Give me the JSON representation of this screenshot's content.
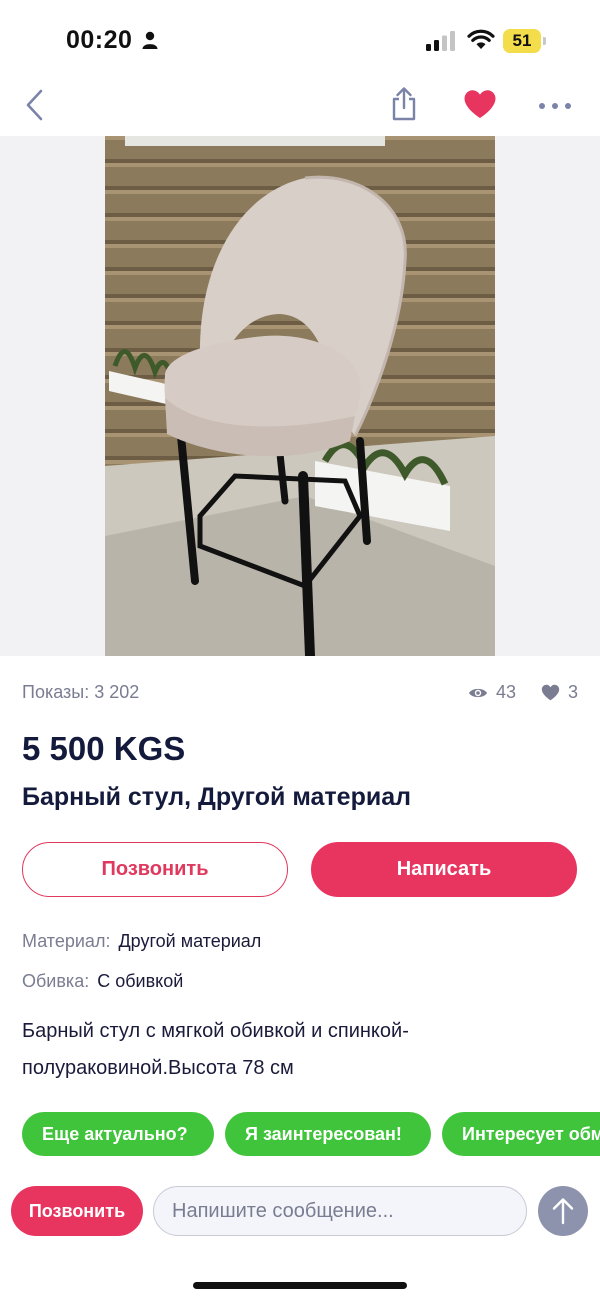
{
  "status_bar": {
    "time": "00:20",
    "battery": "51"
  },
  "listing": {
    "impressions": "Показы: 3 202",
    "views": "43",
    "likes": "3",
    "price": "5 500 KGS",
    "title": "Барный стул, Другой материал"
  },
  "actions": {
    "call_label": "Позвонить",
    "write_label": "Написать"
  },
  "attributes": [
    {
      "label": "Материал:",
      "value": "Другой материал"
    },
    {
      "label": "Обивка:",
      "value": "С обивкой"
    }
  ],
  "description": "Барный стул с мягкой обивкой и спинкой-полураковиной.Высота 78 см",
  "quick_replies": [
    "Еще актуально?",
    "Я заинтересован!",
    "Интересует обмен"
  ],
  "composer": {
    "call_label": "Позвонить",
    "placeholder": "Напишите сообщение..."
  },
  "colors": {
    "accent": "#e8355f",
    "chip": "#3fc43b",
    "send": "#8e93ad",
    "battery": "#f4dd4a"
  },
  "icons": [
    "person-icon",
    "signal-icon",
    "wifi-icon",
    "back-icon",
    "share-icon",
    "heart-icon",
    "more-icon",
    "eye-icon",
    "send-arrow-icon"
  ]
}
